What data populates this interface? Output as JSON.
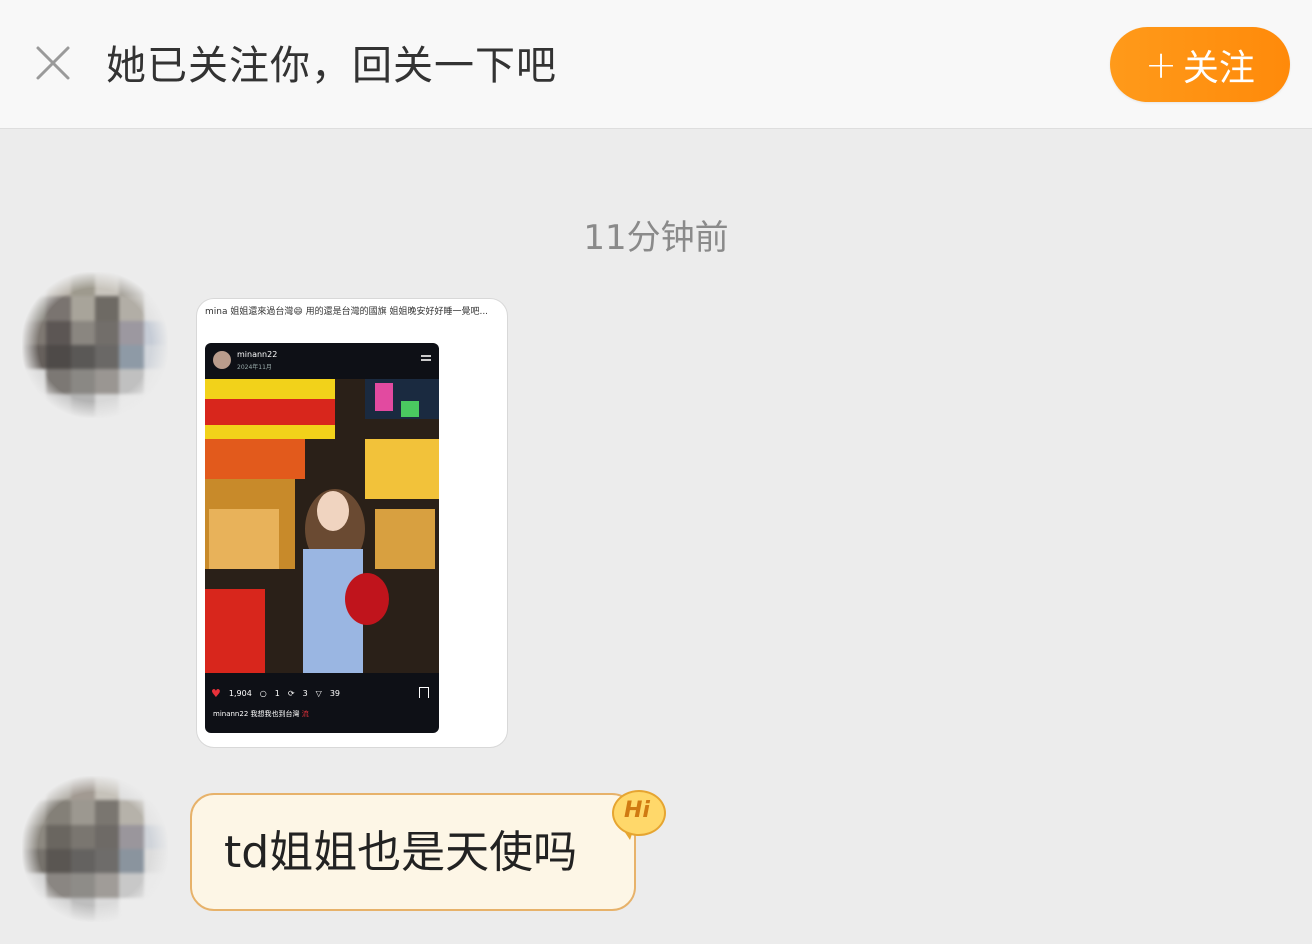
{
  "header": {
    "close_icon": "close-icon",
    "title": "她已关注你，回关一下吧",
    "follow_button_label": "关注",
    "follow_button_prefix": "+",
    "follow_button_color": "#ff8f12"
  },
  "chat": {
    "timestamp": "11分钟前",
    "messages": [
      {
        "type": "image",
        "card": {
          "caption": "mina 姐姐還來過台灣😄 用的還是台灣的國旗 姐姐晚安好好睡一覺吧...",
          "post": {
            "username": "minann22",
            "date": "2024年11月",
            "likes": "1,904",
            "comments": "1",
            "reposts": "3",
            "shares": "39",
            "caption_user": "minann22",
            "caption_text": "我想我也到台灣",
            "caption_tag": "流"
          }
        }
      },
      {
        "type": "text",
        "text": "td姐姐也是天使吗",
        "badge": "Hi",
        "bubble_color": "#fdf6e6",
        "bubble_border": "#e7b26a"
      }
    ]
  }
}
